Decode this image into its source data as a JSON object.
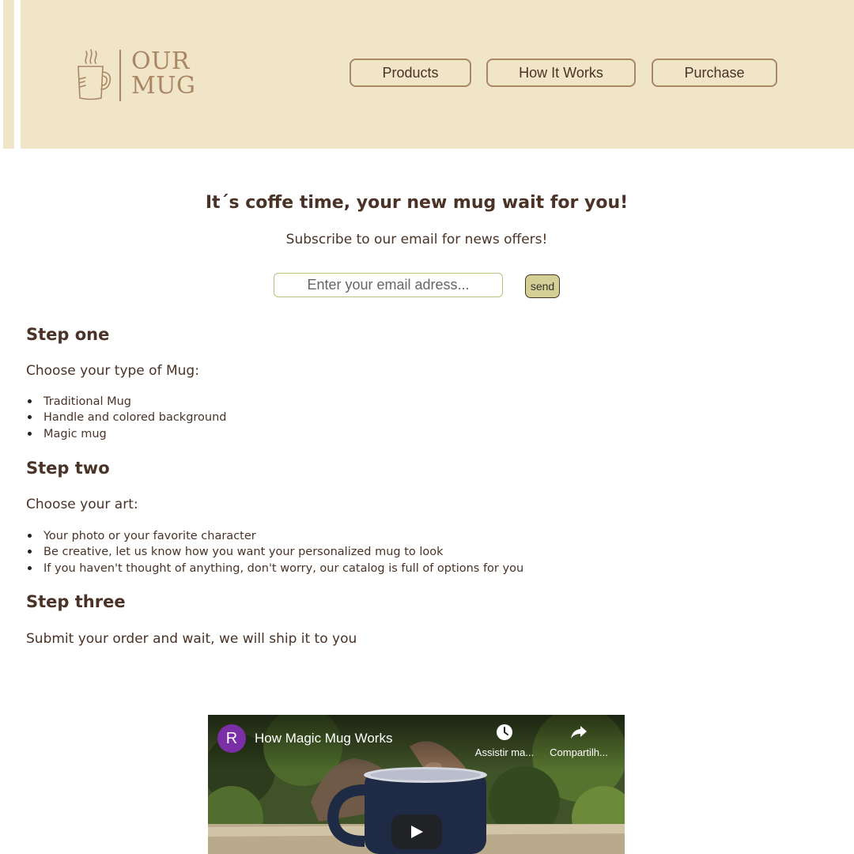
{
  "header": {
    "logo_text_line1": "OUR",
    "logo_text_line2": "MUG",
    "nav": [
      {
        "label": "Products"
      },
      {
        "label": "How It Works"
      },
      {
        "label": "Purchase"
      }
    ]
  },
  "newsletter": {
    "headline": "It´s coffe time, your new mug wait for you!",
    "subline": "Subscribe to our email for news offers!",
    "email_placeholder": "Enter your email adress...",
    "send_label": "send"
  },
  "steps": [
    {
      "title": "Step one",
      "intro": "Choose your type of Mug:",
      "items": [
        "Traditional Mug",
        "Handle and colored background",
        "Magic mug"
      ]
    },
    {
      "title": "Step two",
      "intro": "Choose your art:",
      "items": [
        "Your photo or your favorite character",
        "Be creative, let us know how you want your personalized mug to look",
        "If you haven't thought of anything, don't worry, our catalog is full of options for you"
      ]
    },
    {
      "title": "Step three",
      "intro": "Submit your order and wait, we will ship it to you",
      "items": []
    }
  ],
  "video": {
    "channel_initial": "R",
    "title": "How Magic Mug Works",
    "watch_later_label": "Assistir ma...",
    "share_label": "Compartilh..."
  },
  "colors": {
    "header_bg": "#f1e5c8",
    "accent_brown": "#a98664",
    "text_brown": "#4a3326",
    "send_button_bg": "#d4cf94",
    "avatar_purple": "#7b2fa7"
  }
}
